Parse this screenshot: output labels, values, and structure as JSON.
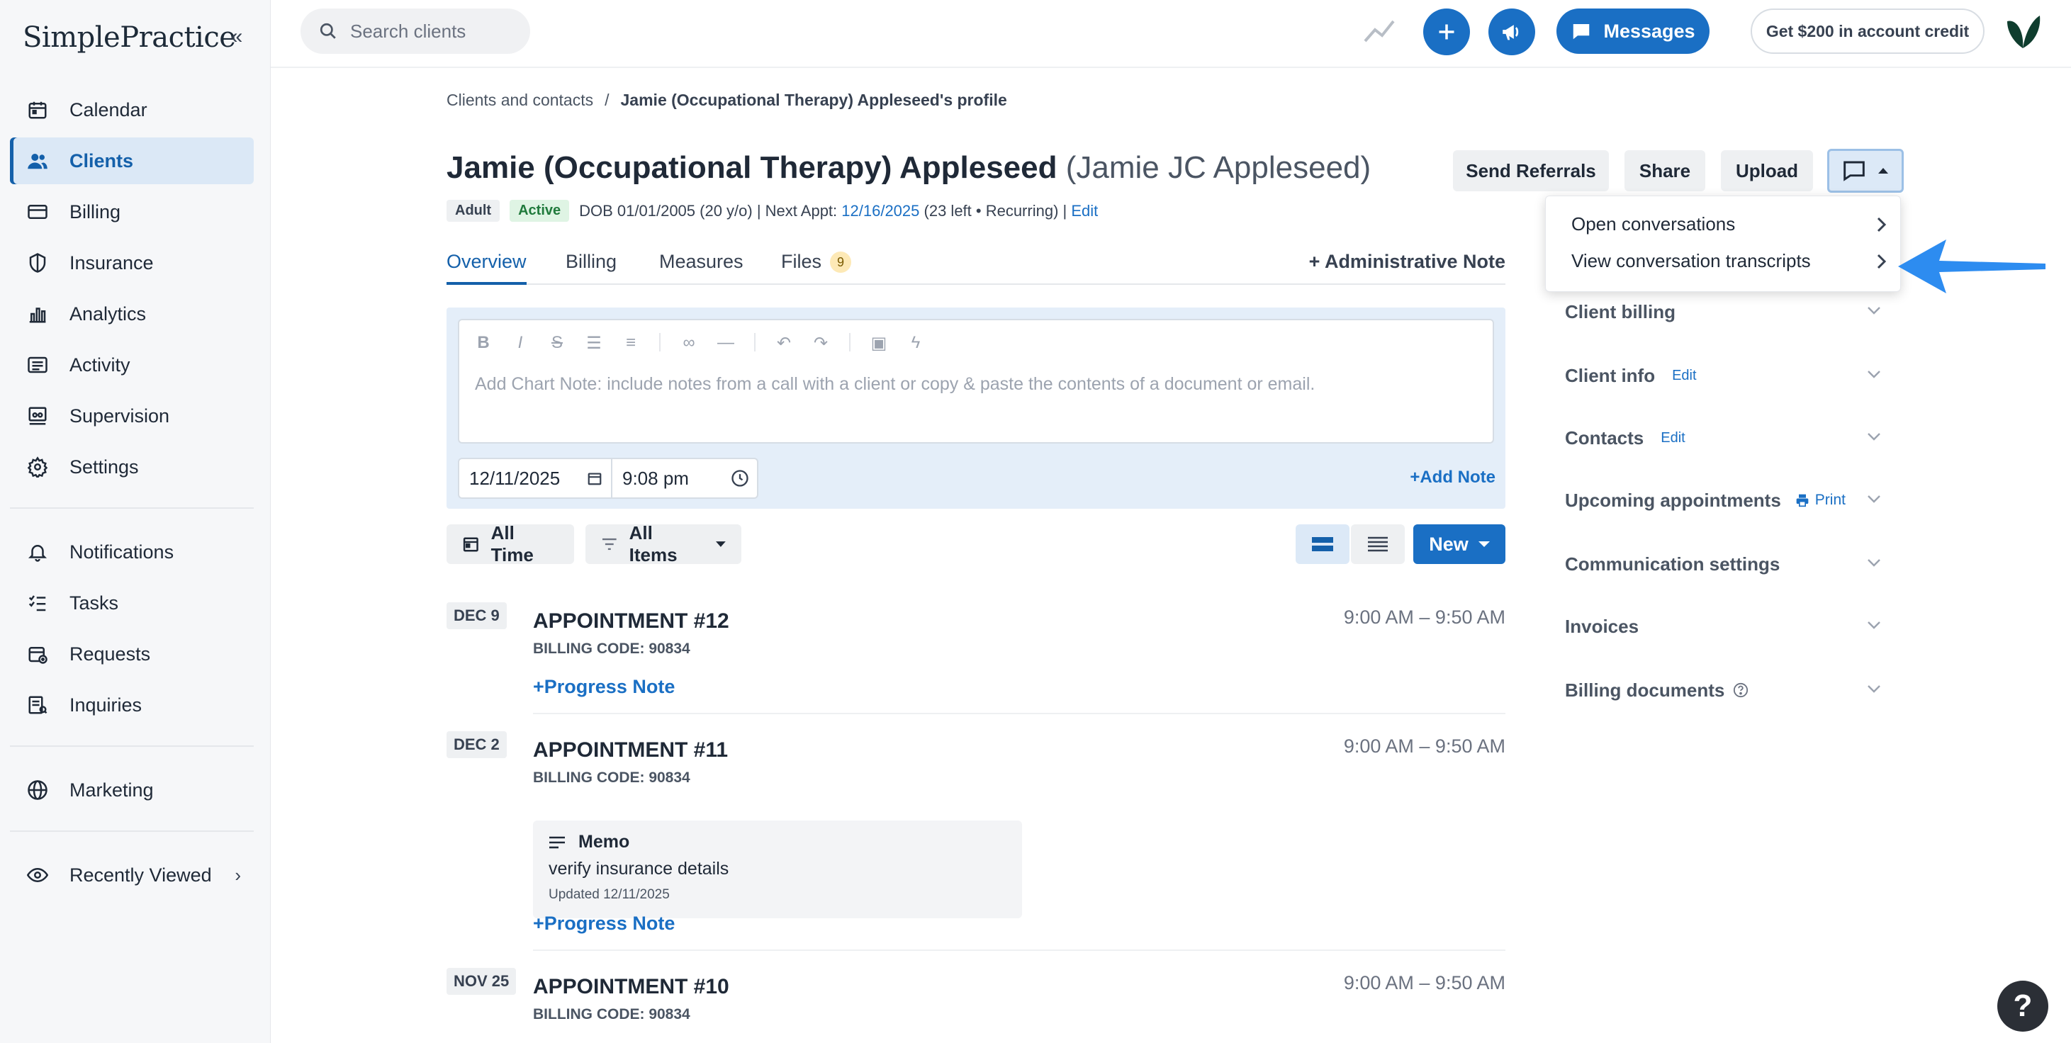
{
  "app": {
    "logo": "SimplePractice"
  },
  "sidebar": {
    "items": [
      {
        "label": "Calendar",
        "icon": "calendar-icon"
      },
      {
        "label": "Clients",
        "icon": "users-icon",
        "active": true
      },
      {
        "label": "Billing",
        "icon": "credit-card-icon"
      },
      {
        "label": "Insurance",
        "icon": "shield-icon"
      },
      {
        "label": "Analytics",
        "icon": "bar-chart-icon"
      },
      {
        "label": "Activity",
        "icon": "list-icon"
      },
      {
        "label": "Supervision",
        "icon": "supervision-icon"
      },
      {
        "label": "Settings",
        "icon": "gear-icon"
      }
    ],
    "secondary": [
      {
        "label": "Notifications",
        "icon": "bell-icon"
      },
      {
        "label": "Tasks",
        "icon": "tasks-icon"
      },
      {
        "label": "Requests",
        "icon": "calendar-plus-icon"
      },
      {
        "label": "Inquiries",
        "icon": "inquiries-icon"
      }
    ],
    "marketing": {
      "label": "Marketing",
      "icon": "globe-icon"
    },
    "recently_viewed": {
      "label": "Recently Viewed",
      "icon": "eye-icon"
    }
  },
  "topbar": {
    "search_placeholder": "Search clients",
    "messages_label": "Messages",
    "credit_label": "Get $200 in account credit"
  },
  "breadcrumb": {
    "root": "Clients and contacts",
    "separator": "/",
    "current": "Jamie (Occupational Therapy) Appleseed's profile"
  },
  "client": {
    "name": "Jamie (Occupational Therapy) Appleseed",
    "alias": "(Jamie JC Appleseed)",
    "badge_type": "Adult",
    "badge_status": "Active",
    "dob_text": "DOB 01/01/2005 (20 y/o) | Next Appt:",
    "next_appt": "12/16/2025",
    "appt_extra": "(23 left • Recurring) |",
    "edit_label": "Edit"
  },
  "header_buttons": {
    "send_referrals": "Send Referrals",
    "share": "Share",
    "upload": "Upload"
  },
  "tabs": [
    {
      "label": "Overview",
      "active": true
    },
    {
      "label": "Billing"
    },
    {
      "label": "Measures"
    },
    {
      "label": "Files",
      "count": "9"
    }
  ],
  "admin_note_label": "+ Administrative Note",
  "note_editor": {
    "placeholder": "Add Chart Note: include notes from a call with a client or copy & paste the contents of a document or email.",
    "date": "12/11/2025",
    "time": "9:08 pm",
    "add_note_label": "Add Note"
  },
  "filters": {
    "time_label": "All Time",
    "items_label": "All Items",
    "new_label": "New"
  },
  "appointments": [
    {
      "date": "DEC 9",
      "title": "APPOINTMENT #12",
      "code": "BILLING CODE: 90834",
      "time": "9:00 AM – 9:50 AM",
      "action": "Progress Note"
    },
    {
      "date": "DEC 2",
      "title": "APPOINTMENT #11",
      "code": "BILLING CODE: 90834",
      "time": "9:00 AM – 9:50 AM",
      "action": "Progress Note",
      "memo": {
        "title": "Memo",
        "body": "verify insurance details",
        "updated": "Updated 12/11/2025"
      }
    },
    {
      "date": "NOV 25",
      "title": "APPOINTMENT #10",
      "code": "BILLING CODE: 90834",
      "time": "9:00 AM – 9:50 AM"
    }
  ],
  "right_panel": {
    "sections": [
      {
        "label": "Client billing"
      },
      {
        "label": "Client info",
        "edit": "Edit"
      },
      {
        "label": "Contacts",
        "edit": "Edit"
      },
      {
        "label": "Upcoming appointments",
        "print": "Print"
      },
      {
        "label": "Communication settings"
      },
      {
        "label": "Invoices"
      },
      {
        "label": "Billing documents"
      }
    ]
  },
  "conversation_menu": {
    "items": [
      {
        "label": "Open conversations"
      },
      {
        "label": "View conversation transcripts"
      }
    ]
  },
  "colors": {
    "brand_blue": "#1a6fc4",
    "active_nav_bg": "#dbe8f6",
    "arrow_blue": "#2d8cf0"
  },
  "help": {
    "label": "?"
  }
}
